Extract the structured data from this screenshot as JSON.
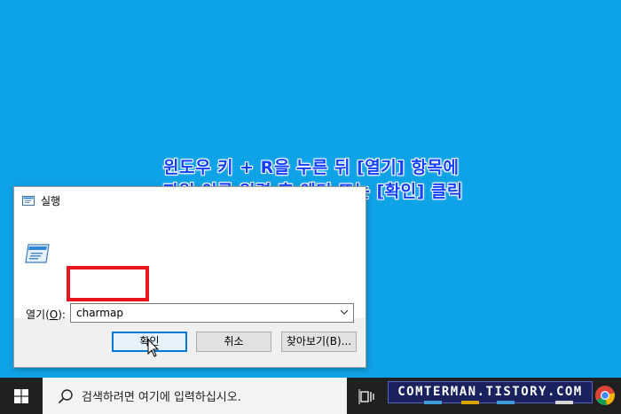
{
  "annotation": {
    "line1": "윈도우 키 + R을 누른 뒤 [열기] 항목에",
    "line2": "파일 이름 입력 후 엔터 또는 [확인] 클릭"
  },
  "dialog": {
    "title": "실행",
    "open_label": "열기(",
    "open_hotkey": "O",
    "open_label_end": "):",
    "input_value": "charmap",
    "buttons": {
      "ok": "확인",
      "cancel": "취소",
      "browse": "찾아보기(B)..."
    }
  },
  "taskbar": {
    "search_placeholder": "검색하려면 여기에 입력하십시오.",
    "watermark": "COMTERMAN.TISTORY.COM"
  },
  "colors": {
    "desktop": "#0ea2e6",
    "annotation_text": "#1240ff",
    "highlight": "#e8141e",
    "taskbar": "#202020"
  },
  "icons": [
    "run-icon",
    "chevron-down-icon",
    "cursor-icon",
    "windows-logo-icon",
    "search-icon",
    "task-view-icon",
    "chrome-icon"
  ]
}
